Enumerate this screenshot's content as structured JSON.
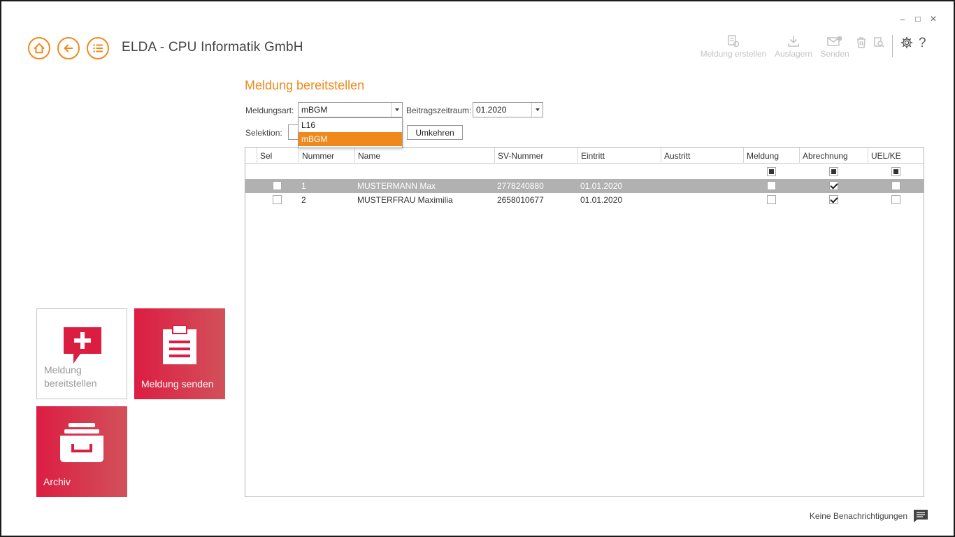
{
  "window": {
    "minimize": "–",
    "maximize": "□",
    "close": "✕"
  },
  "header": {
    "app_title": "ELDA - CPU Informatik GmbH"
  },
  "toolbar": {
    "meldung_erstellen": "Meldung erstellen",
    "auslagern": "Auslagern",
    "senden": "Senden"
  },
  "colors": {
    "accent": "#f0891c",
    "tile_red": "#dc1d42",
    "tile_red_end": "#d2515a"
  },
  "page": {
    "title": "Meldung bereitstellen"
  },
  "form": {
    "meldungsart_label": "Meldungsart:",
    "meldungsart_value": "mBGM",
    "meldungsart_options": [
      "L16",
      "mBGM"
    ],
    "beitragszeitraum_label": "Beitragszeitraum:",
    "beitragszeitraum_value": "01.2020",
    "selektion_label": "Selektion:",
    "umkehren_label": "Umkehren"
  },
  "grid": {
    "columns": [
      "Sel",
      "Nummer",
      "Name",
      "SV-Nummer",
      "Eintritt",
      "Austritt",
      "Meldung",
      "Abrechnung",
      "UEL/KE"
    ],
    "rows": [
      {
        "nummer": "1",
        "name": "MUSTERMANN Max",
        "sv_nummer": "2778240880",
        "eintritt": "01.01.2020",
        "austritt": "",
        "meldung": false,
        "abrechnung": true,
        "uel_ke": false,
        "selected": true
      },
      {
        "nummer": "2",
        "name": "MUSTERFRAU Maximilia",
        "sv_nummer": "2658010677",
        "eintritt": "01.01.2020",
        "austritt": "",
        "meldung": false,
        "abrechnung": true,
        "uel_ke": false,
        "selected": false
      }
    ]
  },
  "tiles": {
    "bereitstellen": "Meldung bereitstellen",
    "bereitstellen_line1": "Meldung",
    "bereitstellen_line2": "bereitstellen",
    "senden": "Meldung senden",
    "archiv": "Archiv"
  },
  "footer": {
    "notifications": "Keine Benachrichtigungen"
  }
}
